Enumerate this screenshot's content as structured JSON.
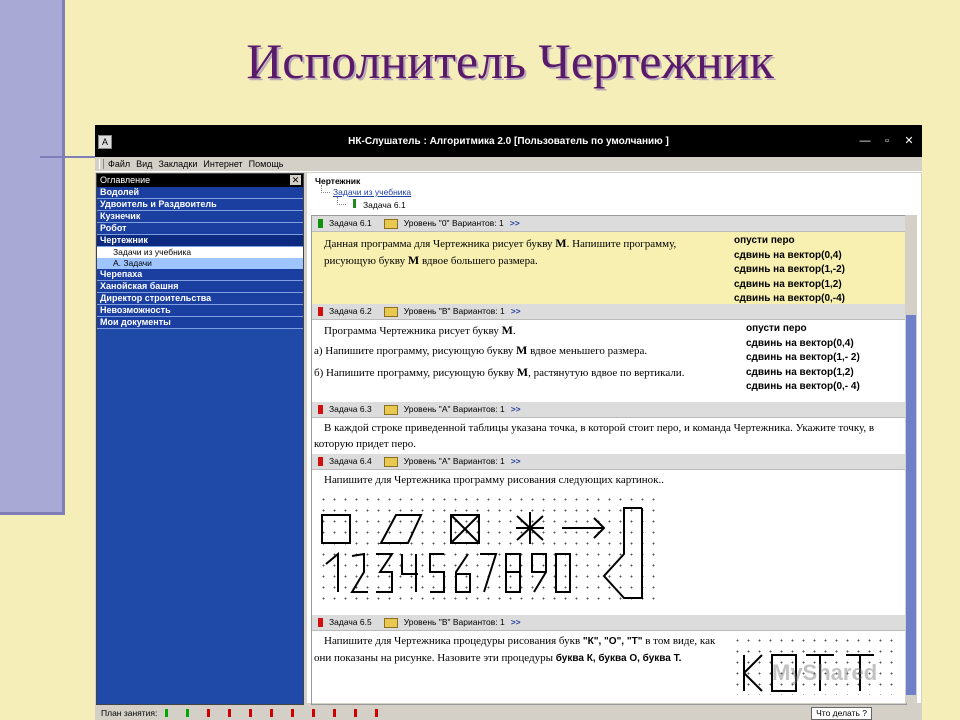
{
  "slide": {
    "title": "Исполнитель Чертежник"
  },
  "window": {
    "title": "НК-Слушатель : Алгоритмика 2.0 [Пользователь по умолчанию ]",
    "controls": [
      "—",
      "▫",
      "✕"
    ]
  },
  "menu": [
    "Файл",
    "Вид",
    "Закладки",
    "Интернет",
    "Помощь"
  ],
  "toc": {
    "header": "Оглавление",
    "close": "✕",
    "items_top": [
      "Водолей",
      "Удвоитель и Раздвоитель",
      "Кузнечик",
      "Робот",
      "Чертежник"
    ],
    "sub_items": [
      "Задачи из учебника",
      "А. Задачи"
    ],
    "items_bottom": [
      "Черепаха",
      "Ханойская башня",
      "Директор строительства",
      "Невозможность",
      "Мои документы"
    ]
  },
  "breadcrumb": {
    "root": "Чертежник",
    "section": "Задачи из учебника",
    "task": "Задача 6.1"
  },
  "tasks": [
    {
      "id": "Задача 6.1",
      "level": "Уровень \"0\"",
      "variants": "Вариантов: 1",
      "status": "green",
      "text": "Данная программа для Чертежника рисует букву",
      "letter": "M",
      "text2": ". Напишите программу, рисующую букву",
      "letter2": "M",
      "text3": "вдвое большего размера.",
      "commands": [
        "опусти перо",
        "сдвинь на вектор(0,4)",
        "сдвинь на вектор(1,-2)",
        "сдвинь на вектор(1,2)",
        "сдвинь на вектор(0,-4)"
      ]
    },
    {
      "id": "Задача 6.2",
      "level": "Уровень \"В\"",
      "variants": "Вариантов: 1",
      "status": "red",
      "line1": "Программа Чертежника рисует букву",
      "line2a": "а) Напишите программу, рисующую букву",
      "line2b": "вдвое меньшего размера.",
      "line3a": "б) Напишите программу, рисующую букву",
      "line3b": ", растянутую вдвое по вертикали.",
      "letter": "M",
      "commands": [
        "опусти перо",
        "сдвинь на вектор(0,4)",
        "сдвинь на вектор(1,- 2)",
        "сдвинь на вектор(1,2)",
        "сдвинь на вектор(0,- 4)"
      ]
    },
    {
      "id": "Задача 6.3",
      "level": "Уровень \"А\"",
      "variants": "Вариантов: 1",
      "status": "red",
      "text": "В каждой строке приведенной таблицы указана точка, в которой стоит перо, и команда Чертежника. Укажите точку, в которую придет перо."
    },
    {
      "id": "Задача 6.4",
      "level": "Уровень \"А\"",
      "variants": "Вариантов: 1",
      "status": "red",
      "text": "Напишите для Чертежника программу рисования следующих картинок.."
    },
    {
      "id": "Задача 6.5",
      "level": "Уровень \"В\"",
      "variants": "Вариантов: 1",
      "status": "red",
      "text_a": "Напишите для Чертежника процедуры рисования букв",
      "letters_q": "\"К\", \"О\", \"Т\"",
      "text_b": "в том виде, как они показаны на рисунке. Назовите эти процедуры",
      "names": "буква К, буква О, буква Т."
    }
  ],
  "statusbar": {
    "label": "План занятия:",
    "help": "Что делать ?"
  },
  "watermark": "MyShared"
}
